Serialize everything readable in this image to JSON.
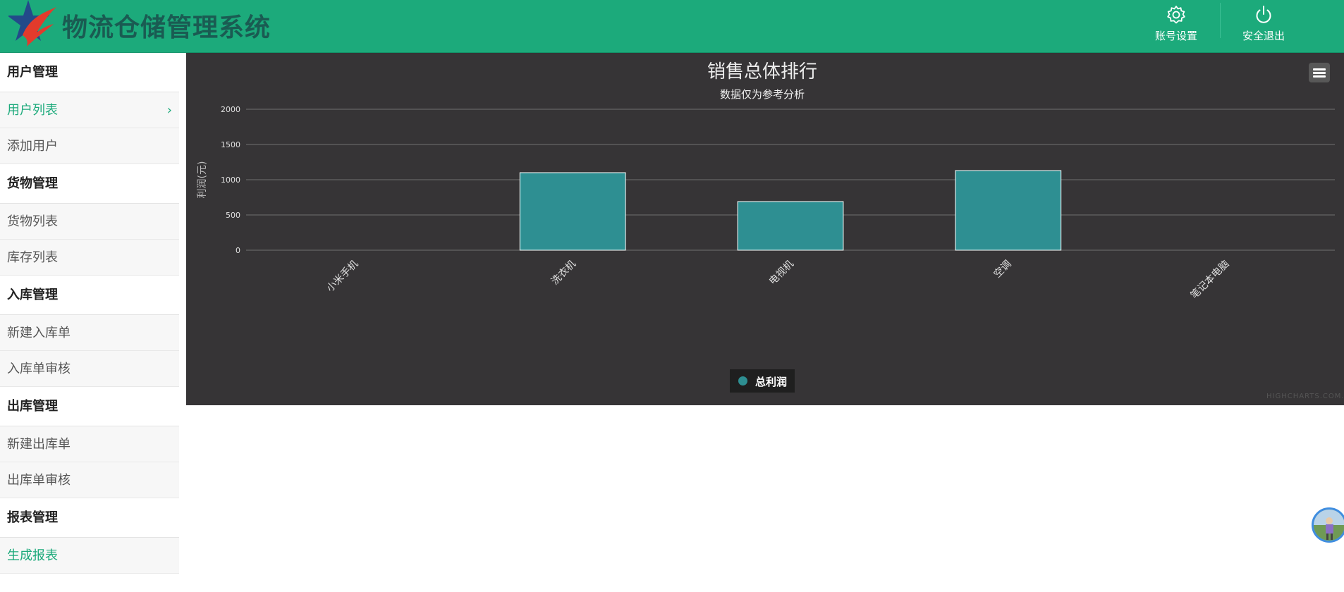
{
  "header": {
    "app_title": "物流仓储管理系统",
    "logo_icon": "star-logo-icon",
    "brand_color": "#1caa7b",
    "account_settings": {
      "label": "账号设置",
      "icon": "gear-icon"
    },
    "logout": {
      "label": "安全退出",
      "icon": "power-icon"
    }
  },
  "sidebar": {
    "accent_color": "#1caa7b",
    "groups": [
      {
        "title": "用户管理",
        "items": [
          {
            "label": "用户列表",
            "active": true
          },
          {
            "label": "添加用户"
          }
        ]
      },
      {
        "title": "货物管理",
        "items": [
          {
            "label": "货物列表"
          },
          {
            "label": "库存列表"
          }
        ]
      },
      {
        "title": "入库管理",
        "items": [
          {
            "label": "新建入库单"
          },
          {
            "label": "入库单审核"
          }
        ]
      },
      {
        "title": "出库管理",
        "items": [
          {
            "label": "新建出库单"
          },
          {
            "label": "出库单审核"
          }
        ]
      },
      {
        "title": "报表管理",
        "items": [
          {
            "label": "生成报表",
            "active": true
          }
        ]
      }
    ]
  },
  "chart_data": {
    "type": "bar",
    "title": "销售总体排行",
    "subtitle": "数据仅为参考分析",
    "xlabel": "",
    "ylabel": "利润(元)",
    "categories": [
      "小米手机",
      "洗衣机",
      "电视机",
      "空调",
      "笔记本电脑"
    ],
    "series": [
      {
        "name": "总利润",
        "values": [
          0,
          1100,
          690,
          1130,
          0
        ],
        "color": "#2e8f92"
      }
    ],
    "ylim": [
      0,
      2000
    ],
    "yticks": [
      0,
      500,
      1000,
      1500,
      2000
    ],
    "grid": true,
    "legend_position": "bottom-center",
    "background": "#363436",
    "credits": "HIGHCHARTS.COM.CN",
    "menu_icon": "hamburger-menu-icon"
  },
  "avatar_icon": "user-avatar-icon"
}
